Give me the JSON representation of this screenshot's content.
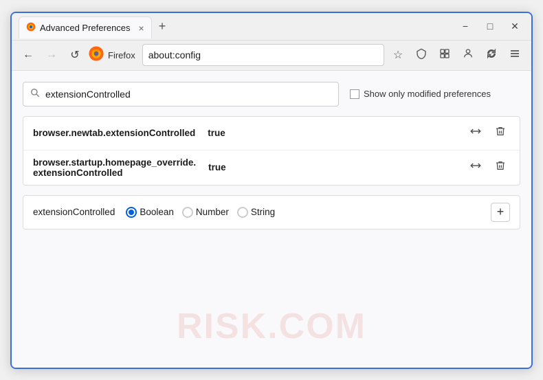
{
  "window": {
    "title": "Advanced Preferences",
    "tab_label": "Advanced Preferences",
    "tab_close": "×",
    "tab_new": "+",
    "controls": {
      "minimize": "−",
      "maximize": "□",
      "close": "✕"
    }
  },
  "navbar": {
    "back": "←",
    "forward": "→",
    "refresh": "↺",
    "address": "about:config",
    "browser_name": "Firefox",
    "icons": {
      "star": "☆",
      "shield": "🛡",
      "extension": "🧩",
      "profile": "👤",
      "sync": "↻",
      "menu": "≡"
    }
  },
  "search": {
    "placeholder": "extensionControlled",
    "value": "extensionControlled",
    "show_modified_label": "Show only modified preferences",
    "checked": false
  },
  "results": [
    {
      "name": "browser.newtab.extensionControlled",
      "value": "true",
      "multiline": false
    },
    {
      "name1": "browser.startup.homepage_override.",
      "name2": "extensionControlled",
      "value": "true",
      "multiline": true
    }
  ],
  "add_row": {
    "name": "extensionControlled",
    "types": [
      {
        "label": "Boolean",
        "selected": true
      },
      {
        "label": "Number",
        "selected": false
      },
      {
        "label": "String",
        "selected": false
      }
    ],
    "add_btn": "+"
  },
  "watermark": "RISK.COM",
  "icons": {
    "search": "🔍",
    "toggle": "⇌",
    "delete": "🗑",
    "add": "+"
  }
}
